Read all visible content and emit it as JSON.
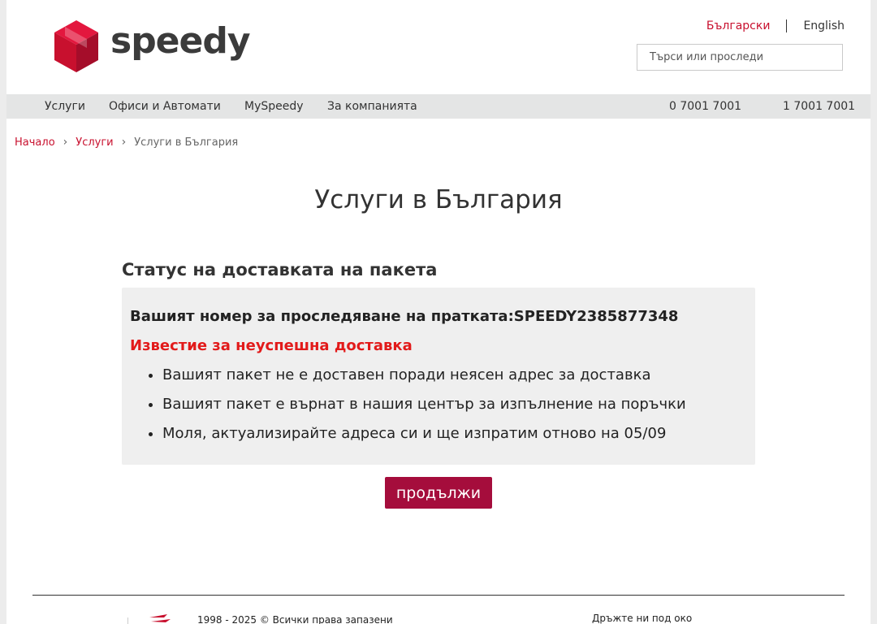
{
  "header": {
    "logo_text": "speedy",
    "lang_bg": "Български",
    "lang_en": "English",
    "search_placeholder": "Търси или проследи"
  },
  "nav": {
    "items": [
      "Услуги",
      "Офиси и Автомати",
      "MySpeedy",
      "За компанията"
    ],
    "phone_1": "0 7001 7001",
    "phone_2": "1 7001 7001"
  },
  "breadcrumb": [
    "Начало",
    "Услуги",
    "Услуги в България"
  ],
  "main": {
    "title": "Услуги в България",
    "status_heading": "Статус на доставката на пакета",
    "tracking_text": "Вашият номер за проследяване на пратката:SPEEDY2385877348",
    "notice": "Известие за неуспешна доставка",
    "bullets": [
      "Вашият пакет не е доставен поради неясен адрес за доставка",
      "Вашият пакет е върнат в нашия център за изпълнение на поръчки",
      "Моля, актуализирайте адреса си и ще изпратим отново на 05/09"
    ],
    "continue_label": "продължи"
  },
  "footer": {
    "copyright": "1998 - 2025 © Всички права запазени",
    "follow": "Дръжте ни под око"
  },
  "colors": {
    "brand_red": "#c8102e",
    "button": "#a50d3c",
    "notice_red": "#e21a1a",
    "nav_bg": "#e4e5e5",
    "box_bg": "#efefef"
  }
}
